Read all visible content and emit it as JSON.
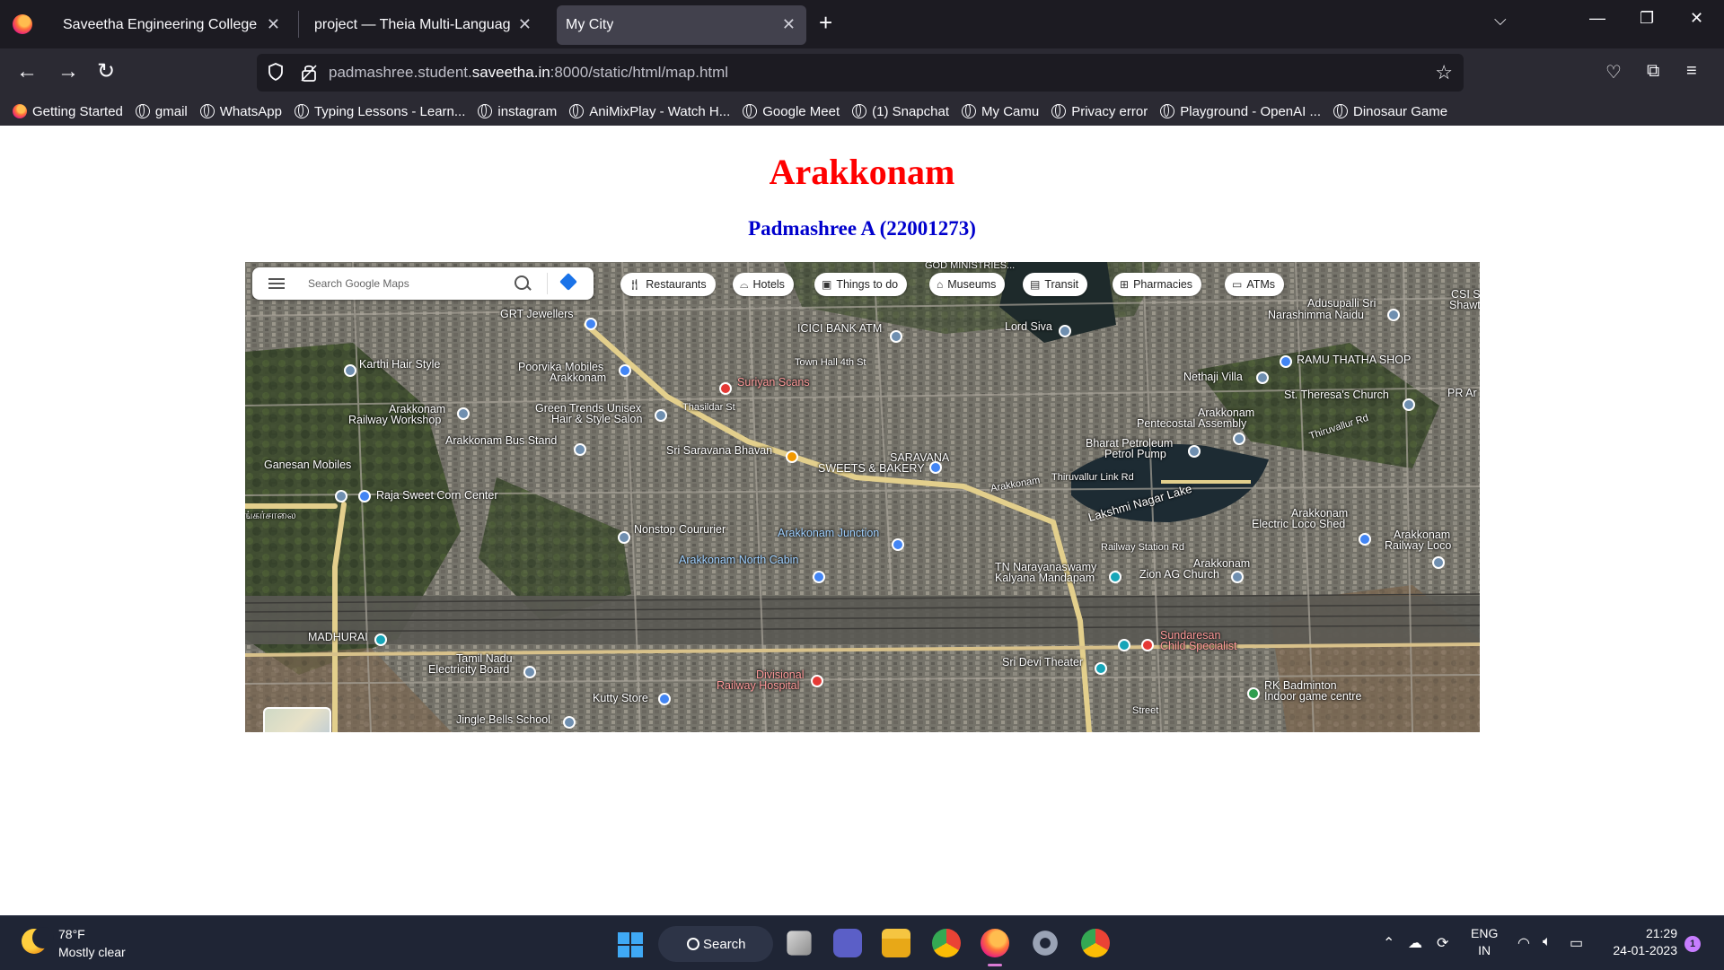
{
  "browser": {
    "tabs": [
      {
        "title": "Saveetha Engineering College",
        "active": false
      },
      {
        "title": "project — Theia Multi-Language Ex",
        "active": false
      },
      {
        "title": "My City",
        "active": true
      }
    ],
    "url_prefix": "padmashree.student.",
    "url_domain": "saveetha.in",
    "url_suffix": ":8000/static/html/map.html",
    "bookmarks": [
      {
        "label": "Getting Started",
        "icon": "firefox-icon"
      },
      {
        "label": "gmail",
        "icon": "globe-icon"
      },
      {
        "label": "WhatsApp",
        "icon": "globe-icon"
      },
      {
        "label": "Typing Lessons - Learn...",
        "icon": "globe-icon"
      },
      {
        "label": "instagram",
        "icon": "globe-icon"
      },
      {
        "label": "AniMixPlay - Watch H...",
        "icon": "globe-icon"
      },
      {
        "label": "Google Meet",
        "icon": "globe-icon"
      },
      {
        "label": "(1) Snapchat",
        "icon": "globe-icon"
      },
      {
        "label": "My Camu",
        "icon": "globe-icon"
      },
      {
        "label": "Privacy error",
        "icon": "globe-icon"
      },
      {
        "label": "Playground - OpenAI ...",
        "icon": "globe-icon"
      },
      {
        "label": "Dinosaur Game",
        "icon": "globe-icon"
      }
    ]
  },
  "page": {
    "title": "Arakkonam",
    "subtitle": "Padmashree A (22001273)"
  },
  "map": {
    "search_placeholder": "Search Google Maps",
    "chips": [
      {
        "label": "Restaurants",
        "icon": "fork-knife-icon"
      },
      {
        "label": "Hotels",
        "icon": "bed-icon"
      },
      {
        "label": "Things to do",
        "icon": "camera-icon"
      },
      {
        "label": "Museums",
        "icon": "museum-icon"
      },
      {
        "label": "Transit",
        "icon": "bus-icon"
      },
      {
        "label": "Pharmacies",
        "icon": "pharmacy-icon"
      },
      {
        "label": "ATMs",
        "icon": "atm-icon"
      }
    ],
    "labels": {
      "god_ministries": "GOD MINISTRIES...",
      "grt": "GRT Jewellers",
      "icici": "ICICI BANK ATM",
      "lord_siva": "Lord Siva",
      "adusupalli": "Adusupalli Sri",
      "narashimma": "Narashimma Naidu",
      "csi": "CSI S",
      "shaw": "Shawt",
      "karthi": "Karthi Hair Style",
      "poorvika1": "Poorvika Mobiles",
      "poorvika2": "Arakkonam",
      "town_hall": "Town Hall 4th St",
      "ramu": "RAMU THATHA SHOP",
      "nethaji": "Nethaji Villa",
      "st_theresa": "St. Theresa's Church",
      "pr": "PR Ar",
      "workshop1": "Arakkonam",
      "workshop2": "Railway Workshop",
      "suryam": "Suriyan Scans",
      "green1": "Green Trends Unisex",
      "green2": "Hair & Style Salon",
      "thasildar": "Thasildar St",
      "pentecostal1": "Arakkonam",
      "pentecostal2": "Pentecostal Assembly",
      "thiruvallur_rd": "Thiruvallur Rd",
      "busstand": "Arakkonam Bus Stand",
      "saravana_bhavan": "Sri Saravana Bhavan",
      "saravana1": "SARAVANA",
      "saravana2": "SWEETS & BAKERY",
      "bharat1": "Bharat Petroleum",
      "bharat2": "Petrol Pump",
      "ganesan1": "Ganesan Mobiles",
      "raja": "Raja Sweet Corn Center",
      "arakkonam_road": "Arakkonam",
      "thiruvallur_link": "Thiruvallur Link Rd",
      "lake": "Lakshmi Nagar Lake",
      "loco1": "Arakkonam",
      "loco2": "Electric Loco Shed",
      "loco_right1": "Arakkonam",
      "loco_right2": "Railway Loco",
      "nonstop": "Nonstop Coururier",
      "junction": "Arakkonam Junction",
      "station_rd": "Railway Station Rd",
      "north_cabin": "Arakkonam North Cabin",
      "tn1": "TN Narayanaswamy",
      "tn2": "Kalyana Mandapam",
      "zion1": "Arakkonam",
      "zion2": "Zion AG Church",
      "madhurai": "MADHURAI",
      "tamilnadu1": "Tamil Nadu",
      "tamilnadu2": "Electricity Board",
      "sundaresan1": "Sundaresan",
      "sundaresan2": "Child Specialist",
      "divisional1": "Divisional",
      "divisional2": "Railway Hospital",
      "sri_devi": "Sri Devi Theater",
      "kutty": "Kutty Store",
      "rk1": "RK Badminton",
      "rk2": "Indoor game centre",
      "jingle": "Jingle Bells School",
      "street": "Street",
      "road_left": "ங்கர்சாலை"
    }
  },
  "taskbar": {
    "temperature": "78°F",
    "condition": "Mostly clear",
    "search_label": "Search",
    "lang1": "ENG",
    "lang2": "IN",
    "time": "21:29",
    "date": "24-01-2023",
    "notification_count": "1"
  }
}
